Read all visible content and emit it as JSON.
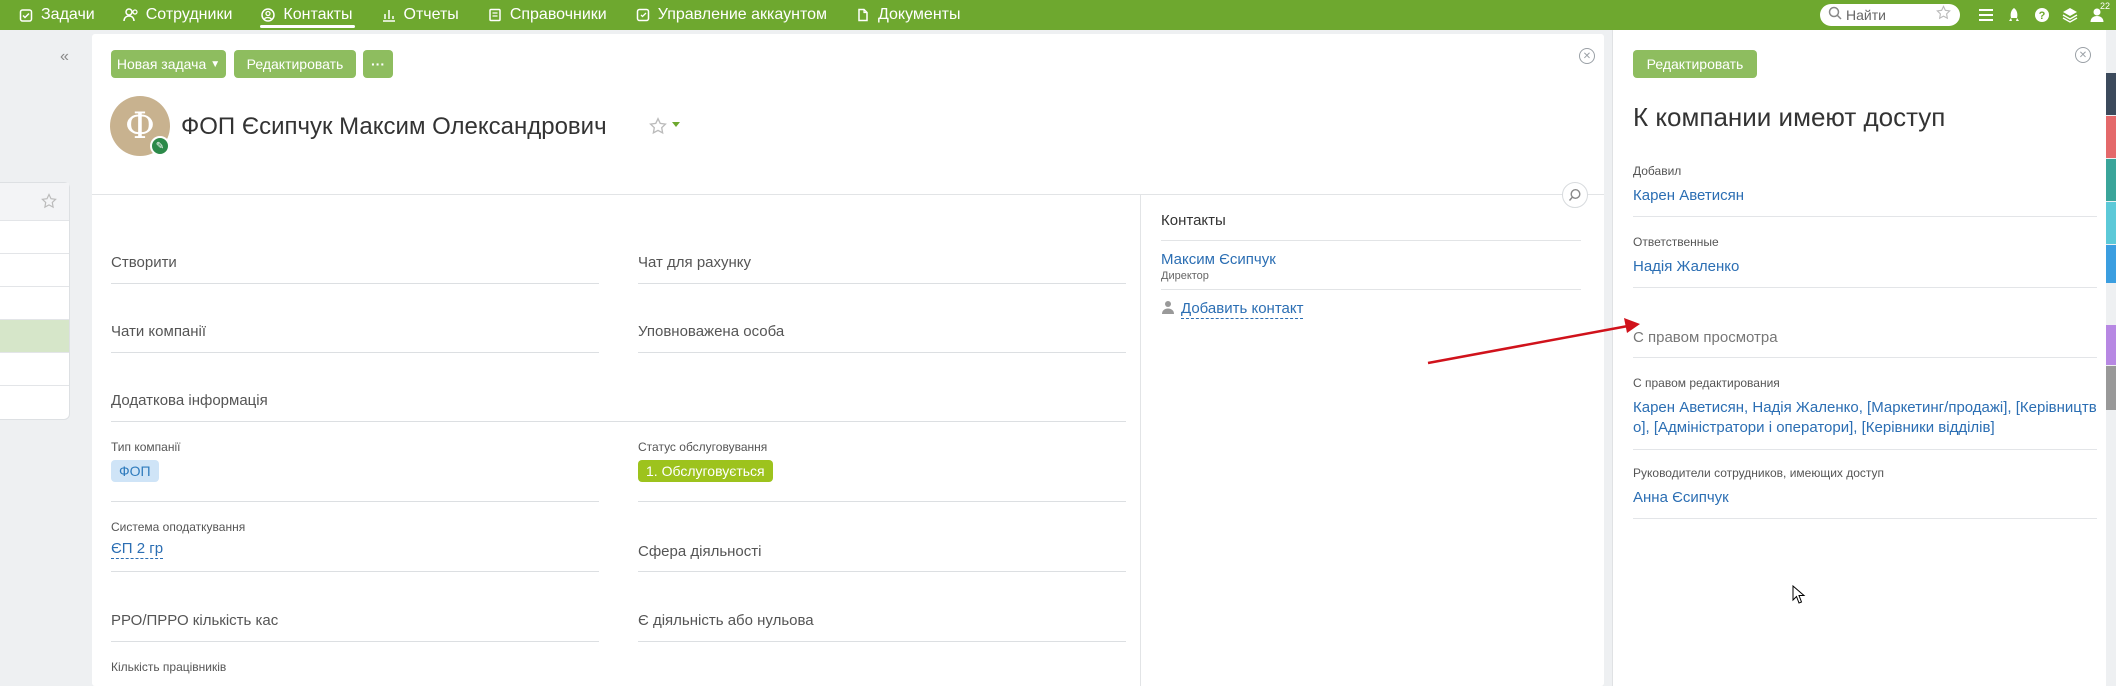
{
  "nav": {
    "items": [
      {
        "label": "Задачи",
        "icon": "tasks-icon"
      },
      {
        "label": "Сотрудники",
        "icon": "employees-icon"
      },
      {
        "label": "Контакты",
        "icon": "contacts-icon",
        "active": true
      },
      {
        "label": "Отчеты",
        "icon": "reports-icon"
      },
      {
        "label": "Справочники",
        "icon": "directories-icon"
      },
      {
        "label": "Управление аккаунтом",
        "icon": "account-icon"
      },
      {
        "label": "Документы",
        "icon": "documents-icon"
      }
    ],
    "search_placeholder": "Найти",
    "user_badge": "22"
  },
  "toolbar": {
    "new_task_label": "Новая задача",
    "edit_label": "Редактировать",
    "more_label": "···"
  },
  "company": {
    "avatar_letter": "Ф",
    "title": "ФОП Єсипчук Максим Олександрович"
  },
  "fields": {
    "create": "Створити",
    "invoice_chat": "Чат для рахунку",
    "company_chats": "Чати компанії",
    "authorized_person": "Уповноважена особа",
    "additional_info": "Додаткова інформація",
    "company_type_label": "Тип компанії",
    "company_type_value": "ФОП",
    "service_status_label": "Статус обслуговування",
    "service_status_value": "1. Обслуговується",
    "tax_system_label": "Система оподаткування",
    "tax_system_value": "ЄП 2 гр",
    "activity_sphere": "Сфера діяльності",
    "rro_count": "РРО/ПРРО кількість кас",
    "activity_or_zero": "Є діяльність або нульова",
    "employee_count_label": "Кількість працівників"
  },
  "contacts": {
    "title": "Контакты",
    "items": [
      {
        "name": "Максим Єсипчук",
        "role": "Директор"
      }
    ],
    "add_label": "Добавить контакт"
  },
  "access_panel": {
    "edit_label": "Редактировать",
    "title": "К компании имеют доступ",
    "added_by_label": "Добавил",
    "added_by_value": "Карен Аветисян",
    "responsible_label": "Ответственные",
    "responsible_value": "Надія Жаленко",
    "view_rights_label": "С правом просмотра",
    "edit_rights_label": "С правом редактирования",
    "edit_rights_value": "Карен Аветисян, Надія Жаленко, [Маркетинг/продажі], [Керівництво], [Адміністратори і оператори], [Керівники відділів]",
    "managers_label": "Руководители сотрудников, имеющих доступ",
    "managers_value": "Анна Єсипчук"
  },
  "colors": {
    "nav_green": "#6ea82f",
    "button_green": "#8ebd5f",
    "link_blue": "#2b6eb3",
    "status_green": "#9dc31d",
    "arrow_red": "#d0121b"
  }
}
